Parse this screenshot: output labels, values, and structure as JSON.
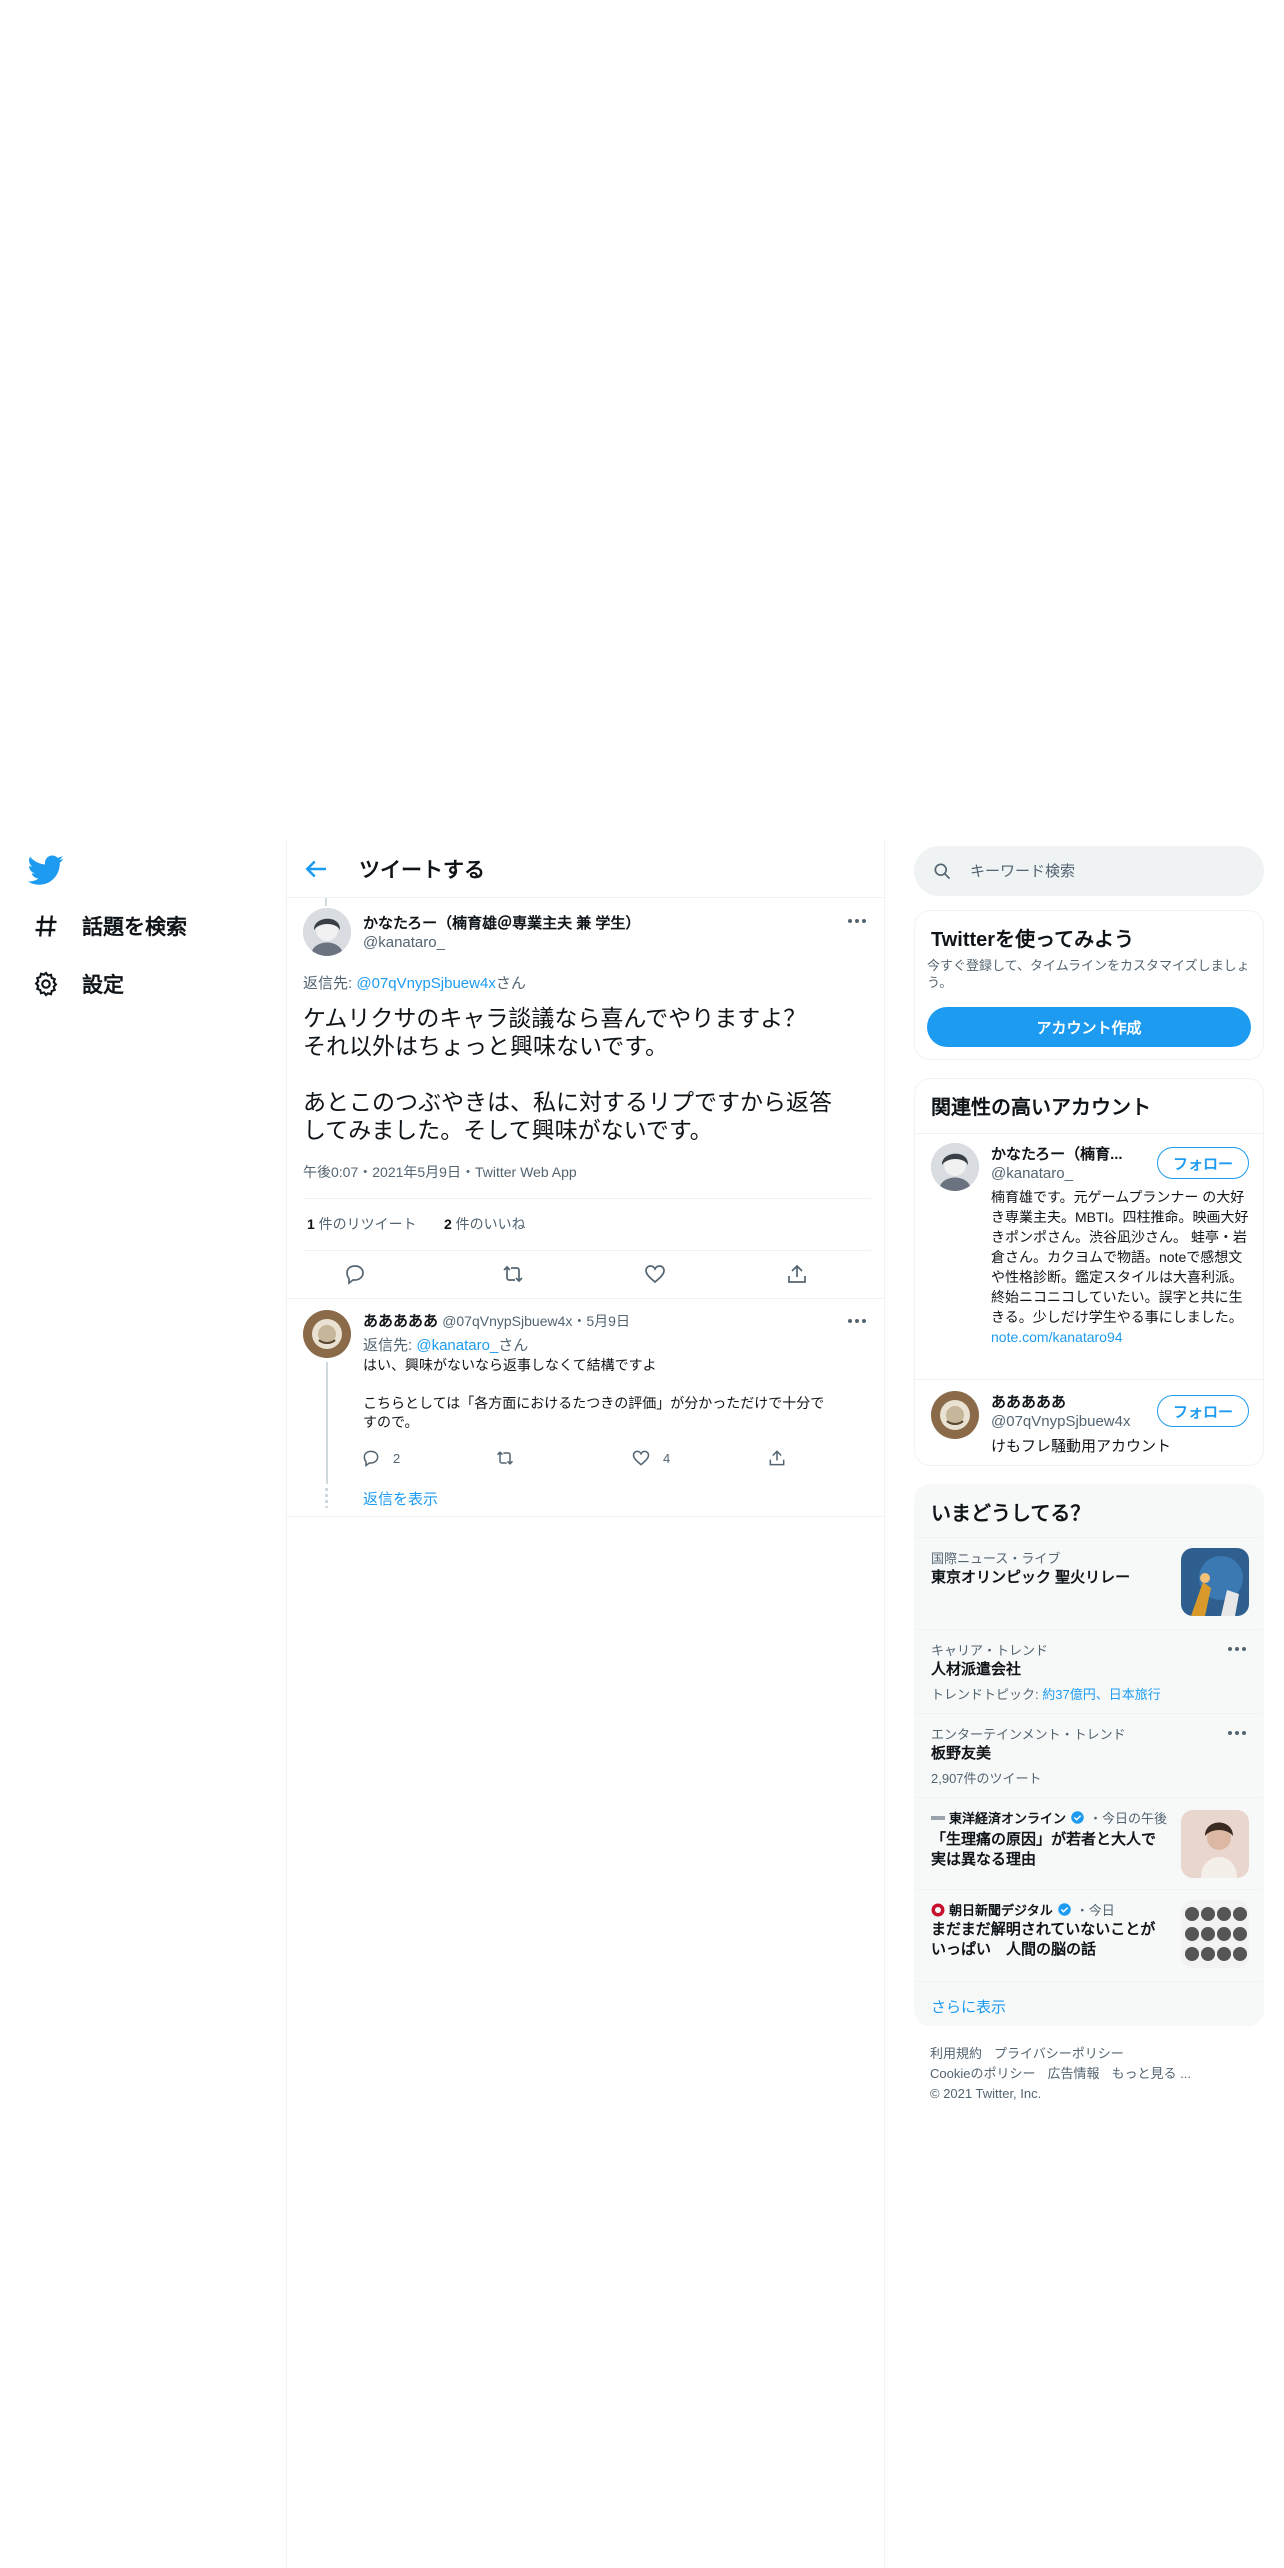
{
  "sidebar": {
    "logo": "twitter-bird-icon",
    "items": [
      {
        "label": "話題を検索",
        "icon": "hashtag-icon"
      },
      {
        "label": "設定",
        "icon": "gear-icon"
      }
    ]
  },
  "header": {
    "title": "ツイートする"
  },
  "tweet": {
    "author_name": "かなたろー（楠育雄＠専業主夫 兼 学生）",
    "author_handle": "@kanataro_",
    "reply_prefix": "返信先: ",
    "reply_to": "@07qVnypSjbuew4x",
    "reply_suffix": "さん",
    "text": "ケムリクサのキャラ談議なら喜んでやりますよ？\nそれ以外はちょっと興味ないです。\n\nあとこのつぶやきは、私に対するリプですから返答\nしてみました。そして興味がないです。",
    "timestamp": "午後0:07・2021年5月9日・Twitter Web App",
    "retweets_count": "1",
    "retweets_label": " 件のリツイート",
    "likes_count": "2",
    "likes_label": " 件のいいね"
  },
  "reply": {
    "author_name": "あああああ",
    "author_handle": "@07qVnypSjbuew4x",
    "date": "・5月9日",
    "reply_prefix": "返信先: ",
    "reply_to": "@kanataro_",
    "reply_suffix": "さん",
    "text": "はい、興味がないなら返事しなくて結構ですよ\n\nこちらとしては「各方面におけるたつきの評価」が分かっただけで十分で\nすので。",
    "reply_count": "2",
    "like_count": "4",
    "show_replies": "返信を表示"
  },
  "search": {
    "placeholder": "キーワード検索"
  },
  "signup": {
    "title": "Twitterを使ってみよう",
    "desc": "今すぐ登録して、タイムラインをカスタマイズしましょう。",
    "button": "アカウント作成"
  },
  "relevant": {
    "title": "関連性の高いアカウント",
    "accounts": [
      {
        "name": "かなたろー（楠育...",
        "handle": "@kanataro_",
        "follow": "フォロー",
        "bio": "楠育雄です。元ゲームプランナー の大好き専業主夫。MBTI。四柱推命。映画大好きポンポさん。渋谷凪沙さん。 蛙亭・岩倉さん。カクヨムで物語。noteで感想文や性格診断。鑑定スタイルは大喜利派。終始ニコニコしていたい。誤字と共に生きる。少しだけ学生やる事にしました。",
        "link": "note.com/kanataro94"
      },
      {
        "name": "あああああ",
        "handle": "@07qVnypSjbuew4x",
        "follow": "フォロー",
        "bio": "けもフレ騒動用アカウント"
      }
    ]
  },
  "trends": {
    "title": "いまどうしてる？",
    "items": [
      {
        "meta": "国際ニュース・ライブ",
        "title": "東京オリンピック 聖火リレー"
      },
      {
        "meta": "キャリア・トレンド",
        "title": "人材派遣会社",
        "sub_prefix": "トレンドトピック: ",
        "sub_links": "約37億円、日本旅行"
      },
      {
        "meta": "エンターテインメント・トレンド",
        "title": "板野友美",
        "sub": "2,907件のツイート"
      },
      {
        "source": "東洋経済オンライン",
        "time": "・今日の午後",
        "title": "「生理痛の原因」が若者と大人で実は異なる理由"
      },
      {
        "source": "朝日新聞デジタル",
        "time": "・今日",
        "title": "まだまだ解明されていないことがいっぱい　人間の脳の話"
      }
    ],
    "show_more": "さらに表示"
  },
  "footer": {
    "links1": [
      "利用規約",
      "プライバシーポリシー"
    ],
    "links2": [
      "Cookieのポリシー",
      "広告情報",
      "もっと見る ..."
    ],
    "copyright": "© 2021 Twitter, Inc."
  },
  "colors": {
    "accent": "#1d9bf0",
    "text": "#0f1419",
    "secondary": "#536471",
    "border": "#eff3f4"
  }
}
